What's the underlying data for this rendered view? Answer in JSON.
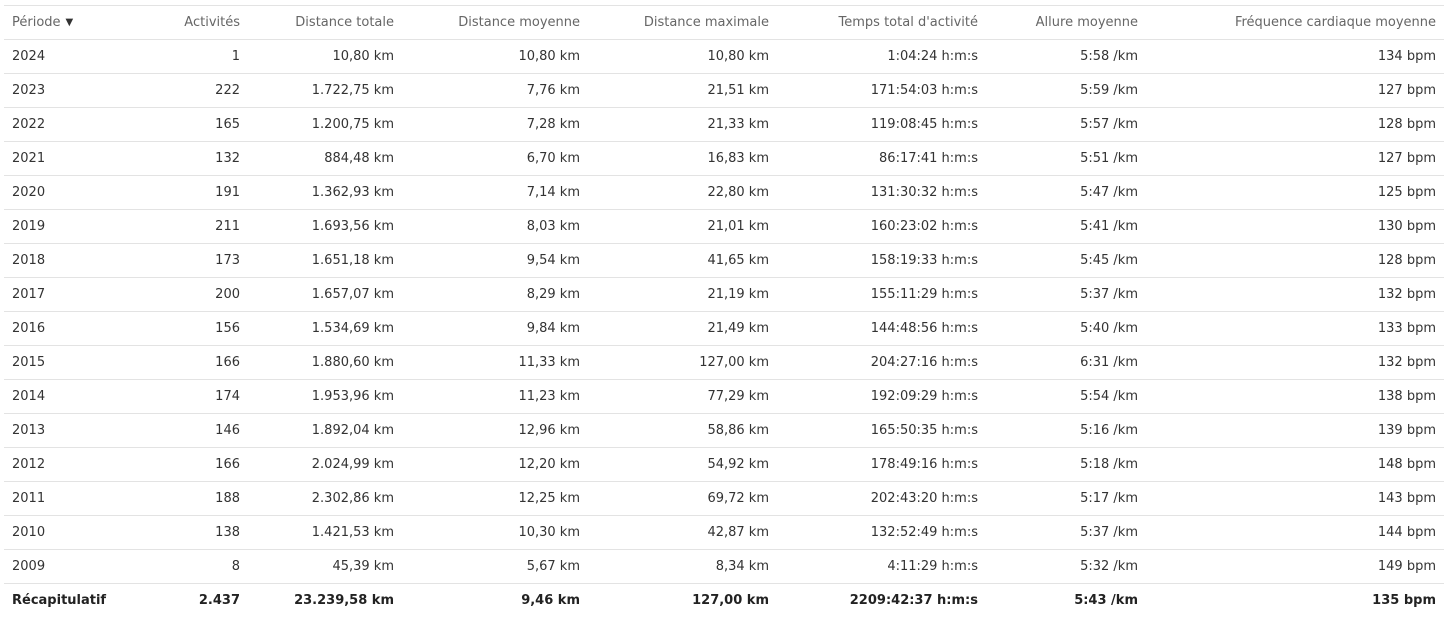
{
  "table": {
    "headers": [
      "Période",
      "Activités",
      "Distance totale",
      "Distance moyenne",
      "Distance maximale",
      "Temps total d'activité",
      "Allure moyenne",
      "Fréquence cardiaque moyenne"
    ],
    "sort_icon": "caret-down-icon",
    "sort_glyph": "▼",
    "rows": [
      [
        "2024",
        "1",
        "10,80 km",
        "10,80 km",
        "10,80 km",
        "1:04:24 h:m:s",
        "5:58 /km",
        "134 bpm"
      ],
      [
        "2023",
        "222",
        "1.722,75 km",
        "7,76 km",
        "21,51 km",
        "171:54:03 h:m:s",
        "5:59 /km",
        "127 bpm"
      ],
      [
        "2022",
        "165",
        "1.200,75 km",
        "7,28 km",
        "21,33 km",
        "119:08:45 h:m:s",
        "5:57 /km",
        "128 bpm"
      ],
      [
        "2021",
        "132",
        "884,48 km",
        "6,70 km",
        "16,83 km",
        "86:17:41 h:m:s",
        "5:51 /km",
        "127 bpm"
      ],
      [
        "2020",
        "191",
        "1.362,93 km",
        "7,14 km",
        "22,80 km",
        "131:30:32 h:m:s",
        "5:47 /km",
        "125 bpm"
      ],
      [
        "2019",
        "211",
        "1.693,56 km",
        "8,03 km",
        "21,01 km",
        "160:23:02 h:m:s",
        "5:41 /km",
        "130 bpm"
      ],
      [
        "2018",
        "173",
        "1.651,18 km",
        "9,54 km",
        "41,65 km",
        "158:19:33 h:m:s",
        "5:45 /km",
        "128 bpm"
      ],
      [
        "2017",
        "200",
        "1.657,07 km",
        "8,29 km",
        "21,19 km",
        "155:11:29 h:m:s",
        "5:37 /km",
        "132 bpm"
      ],
      [
        "2016",
        "156",
        "1.534,69 km",
        "9,84 km",
        "21,49 km",
        "144:48:56 h:m:s",
        "5:40 /km",
        "133 bpm"
      ],
      [
        "2015",
        "166",
        "1.880,60 km",
        "11,33 km",
        "127,00 km",
        "204:27:16 h:m:s",
        "6:31 /km",
        "132 bpm"
      ],
      [
        "2014",
        "174",
        "1.953,96 km",
        "11,23 km",
        "77,29 km",
        "192:09:29 h:m:s",
        "5:54 /km",
        "138 bpm"
      ],
      [
        "2013",
        "146",
        "1.892,04 km",
        "12,96 km",
        "58,86 km",
        "165:50:35 h:m:s",
        "5:16 /km",
        "139 bpm"
      ],
      [
        "2012",
        "166",
        "2.024,99 km",
        "12,20 km",
        "54,92 km",
        "178:49:16 h:m:s",
        "5:18 /km",
        "148 bpm"
      ],
      [
        "2011",
        "188",
        "2.302,86 km",
        "12,25 km",
        "69,72 km",
        "202:43:20 h:m:s",
        "5:17 /km",
        "143 bpm"
      ],
      [
        "2010",
        "138",
        "1.421,53 km",
        "10,30 km",
        "42,87 km",
        "132:52:49 h:m:s",
        "5:37 /km",
        "144 bpm"
      ],
      [
        "2009",
        "8",
        "45,39 km",
        "5,67 km",
        "8,34 km",
        "4:11:29 h:m:s",
        "5:32 /km",
        "149 bpm"
      ]
    ],
    "summary": [
      "Récapitulatif",
      "2.437",
      "23.239,58 km",
      "9,46 km",
      "127,00 km",
      "2209:42:37 h:m:s",
      "5:43 /km",
      "135 bpm"
    ]
  }
}
